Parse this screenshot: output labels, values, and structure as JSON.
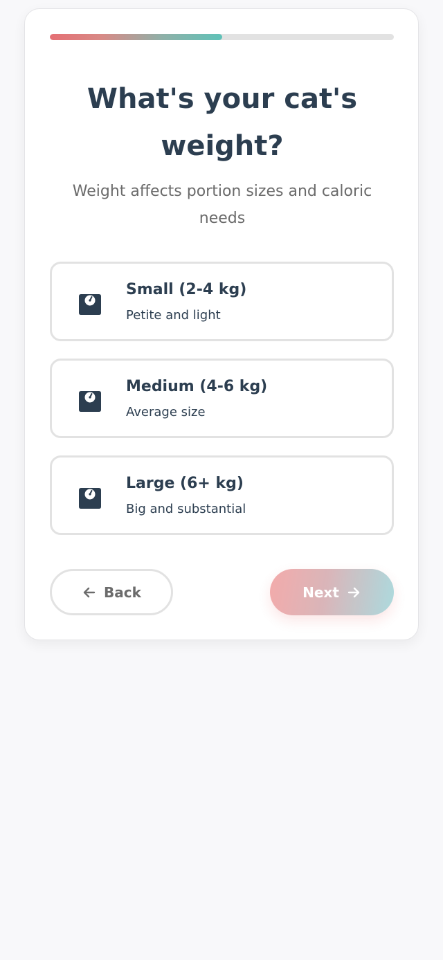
{
  "progress": {
    "value": 0.5
  },
  "header": {
    "title": "What's your cat's weight?",
    "subtitle": "Weight affects portion sizes and caloric needs"
  },
  "options": [
    {
      "label": "Small (2-4 kg)",
      "description": "Petite and light",
      "icon": "weight-scale-icon"
    },
    {
      "label": "Medium (4-6 kg)",
      "description": "Average size",
      "icon": "weight-scale-icon"
    },
    {
      "label": "Large (6+ kg)",
      "description": "Big and substantial",
      "icon": "weight-scale-icon"
    }
  ],
  "nav": {
    "back_label": "Back",
    "next_label": "Next",
    "back_icon": "arrow-left-icon",
    "next_icon": "arrow-right-icon"
  },
  "colors": {
    "heading": "#2c3e50",
    "muted": "#6b6b6b",
    "border": "#e2e2e2",
    "progress_start": "#e56f74",
    "progress_end": "#5fc2b8",
    "next_start": "#f3a6a6",
    "next_end": "#a8d8dc"
  }
}
